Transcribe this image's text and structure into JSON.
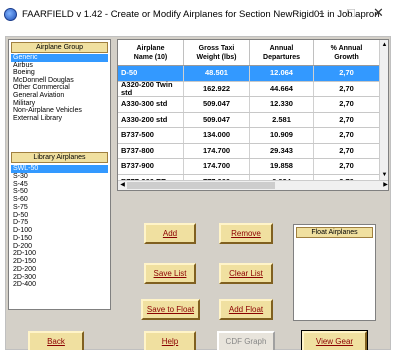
{
  "window": {
    "title": "FAARFIELD v 1.42 - Create or Modify Airplanes for Section NewRigid01 in Job apron",
    "min_glyph": "–",
    "max_glyph": "☐",
    "close_glyph": "✕"
  },
  "airplane_group": {
    "header": "Airplane Group",
    "items": [
      {
        "label": "Generic",
        "selected": true
      },
      {
        "label": "Airbus",
        "selected": false
      },
      {
        "label": "Boeing",
        "selected": false
      },
      {
        "label": "McDonnell Douglas",
        "selected": false
      },
      {
        "label": "Other Commercial",
        "selected": false
      },
      {
        "label": "General Aviation",
        "selected": false
      },
      {
        "label": "Military",
        "selected": false
      },
      {
        "label": "Non-Airplane Vehicles",
        "selected": false
      },
      {
        "label": "External Library",
        "selected": false
      }
    ]
  },
  "library_airplanes": {
    "header": "Library Airplanes",
    "items": [
      {
        "label": "SWL-50",
        "selected": true
      },
      {
        "label": "S-30",
        "selected": false
      },
      {
        "label": "S-45",
        "selected": false
      },
      {
        "label": "S-50",
        "selected": false
      },
      {
        "label": "S-60",
        "selected": false
      },
      {
        "label": "S-75",
        "selected": false
      },
      {
        "label": "D-50",
        "selected": false
      },
      {
        "label": "D-75",
        "selected": false
      },
      {
        "label": "D-100",
        "selected": false
      },
      {
        "label": "D-150",
        "selected": false
      },
      {
        "label": "D-200",
        "selected": false
      },
      {
        "label": "2D-100",
        "selected": false
      },
      {
        "label": "2D-150",
        "selected": false
      },
      {
        "label": "2D-200",
        "selected": false
      },
      {
        "label": "2D-300",
        "selected": false
      },
      {
        "label": "2D-400",
        "selected": false
      }
    ]
  },
  "table": {
    "columns": [
      {
        "line1": "Airplane",
        "line2": "Name (10)"
      },
      {
        "line1": "Gross Taxi",
        "line2": "Weight (lbs)"
      },
      {
        "line1": "Annual",
        "line2": "Departures"
      },
      {
        "line1": "% Annual",
        "line2": "Growth"
      }
    ],
    "rows": [
      {
        "name": "D-50",
        "weight": "48.501",
        "departures": "12.064",
        "growth": "2,70",
        "selected": true
      },
      {
        "name": "A320-200 Twin std",
        "weight": "162.922",
        "departures": "44.664",
        "growth": "2,70",
        "selected": false
      },
      {
        "name": "A330-300 std",
        "weight": "509.047",
        "departures": "12.330",
        "growth": "2,70",
        "selected": false
      },
      {
        "name": "A330-200 std",
        "weight": "509.047",
        "departures": "2.581",
        "growth": "2,70",
        "selected": false
      },
      {
        "name": "B737-500",
        "weight": "134.000",
        "departures": "10.909",
        "growth": "2,70",
        "selected": false
      },
      {
        "name": "B737-800",
        "weight": "174.700",
        "departures": "29.343",
        "growth": "2,70",
        "selected": false
      },
      {
        "name": "B737-900",
        "weight": "174.700",
        "departures": "19.858",
        "growth": "2,70",
        "selected": false
      },
      {
        "name": "B777-300 ER",
        "weight": "777.000",
        "departures": "6.924",
        "growth": "2,70",
        "selected": false
      }
    ]
  },
  "buttons": {
    "add": "Add",
    "remove": "Remove",
    "save_list": "Save List",
    "clear_list": "Clear List",
    "save_to_float": "Save to Float",
    "add_float": "Add Float",
    "back": "Back",
    "help": "Help",
    "cdf_graph": "CDF Graph",
    "view_gear": "View Gear"
  },
  "float_airplanes": {
    "header": "Float Airplanes"
  },
  "colors": {
    "selection": "#3399ff",
    "header_fill": "#f0e0a0",
    "button_text": "#8b0000"
  }
}
